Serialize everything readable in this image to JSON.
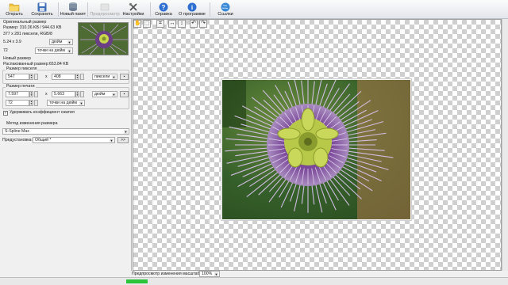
{
  "toolbar": {
    "open": "Открыть",
    "save": "Сохранить",
    "batch": "Новый пакет",
    "preview": "Предпросмотр",
    "settings": "Настройки",
    "help": "Справка",
    "about": "О программе",
    "links": "Ссылки"
  },
  "original": {
    "header": "Оригинальный размер",
    "size": "Размер: 310.36 KB / 944.63 KB",
    "dims": "377 x 281 пиксели, RGB/8",
    "inches": "5.24 x 3.9",
    "inch_unit": "дюйм",
    "dpi": "72",
    "dpi_unit": "точки на дюйм"
  },
  "new_size": {
    "header": "Новый размер",
    "unpacked": "Распакованный размер:653.84 KB",
    "pixel_header": "Размер пикселя",
    "width_px": "547",
    "x1": "x",
    "height_px": "408",
    "px_unit": "пиксели",
    "print_header": "Размер печати",
    "width_in": "7.597",
    "x2": "x",
    "height_in": "5.663",
    "in_unit": "дюйм",
    "dpi": "72",
    "dpi_unit": "точки на дюйм",
    "keep_ratio": "Удерживать коэффициент сжатия"
  },
  "method": {
    "header": "Метод изменения размера",
    "value": "S-Spline Max"
  },
  "preset": {
    "label": "Предустановка:",
    "value": "Общий *",
    "btn": ">>"
  },
  "status": {
    "zoom_label": "Предпросмотр изменения масштаба:",
    "zoom": "100%"
  },
  "colors": {
    "progress": "#2bc43a",
    "selection": "#316ac5"
  }
}
